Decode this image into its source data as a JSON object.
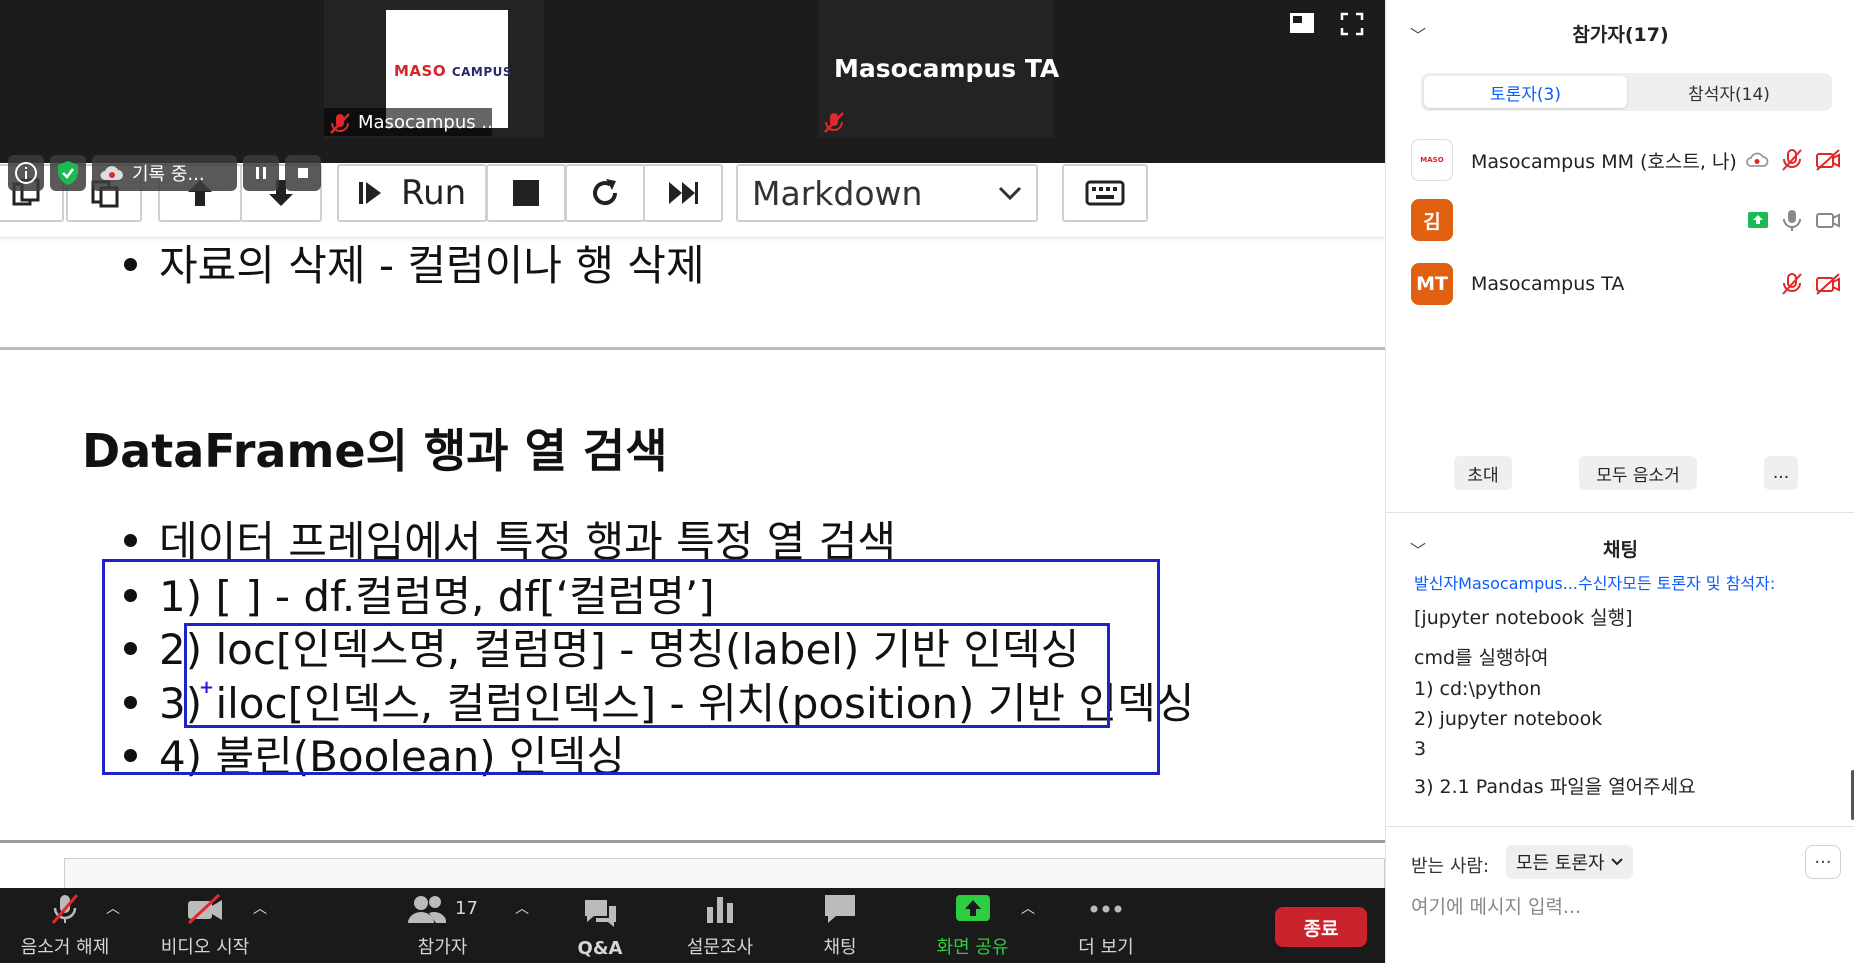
{
  "videos": [
    {
      "name": "Masocampus ...",
      "logo": "MASO CAMPUS"
    },
    {
      "name": "Masocampus TA"
    }
  ],
  "recording": {
    "label": "기록 중..."
  },
  "notebook_toolbar": {
    "run_label": "Run",
    "cell_type": "Markdown"
  },
  "slide": {
    "top_bullet": "자료의 삭제 - 컬럼이나 행 삭제",
    "heading": "DataFrame의 행과 열 검색",
    "bullets": [
      "데이터 프레임에서 특정 행과 특정 열 검색",
      "1) [ ] - df.컬럼명, df[‘컬럼명’]",
      "2) loc[인덱스명, 컬럼명] - 명칭(label) 기반 인덱싱",
      "3) iloc[인덱스, 컬럼인덱스] - 위치(position) 기반 인덱싱",
      "4) 불린(Boolean) 인덱싱"
    ]
  },
  "zoom_bar": {
    "mute_label": "음소거 해제",
    "video_label": "비디오 시작",
    "participants_label": "참가자",
    "participants_count": "17",
    "qa_label": "Q&A",
    "poll_label": "설문조사",
    "chat_label": "채팅",
    "share_label": "화면 공유",
    "more_label": "더 보기",
    "end_label": "종료",
    "share_color": "#2ecc40",
    "end_color": "#c9232d"
  },
  "participants_panel": {
    "title": "참가자(17)",
    "tabs": [
      "토론자(3)",
      "참석자(14)"
    ],
    "panelists": [
      {
        "avatar": "",
        "name": "Masocampus MM (호스트, 나)"
      },
      {
        "avatar": "김",
        "name": "",
        "avatar_color": "#e0600f"
      },
      {
        "avatar": "MT",
        "name": "Masocampus TA",
        "avatar_color": "#e0600f"
      }
    ],
    "invite_label": "초대",
    "mute_all_label": "모두 음소거",
    "more_label": "..."
  },
  "chat_panel": {
    "title": "채팅",
    "lines": [
      "발신자Masocampus...수신자모든 토론자 및 참석자:",
      "[jupyter notebook 실행]",
      "cmd를 실행하여",
      "1)  cd:\\python",
      "2)  jupyter notebook",
      "3",
      "3) 2.1 Pandas 파일을 열어주세요"
    ],
    "recipient_label": "받는 사람:",
    "recipient_value": "모든 토론자",
    "input_placeholder": "여기에 메시지 입력..."
  }
}
